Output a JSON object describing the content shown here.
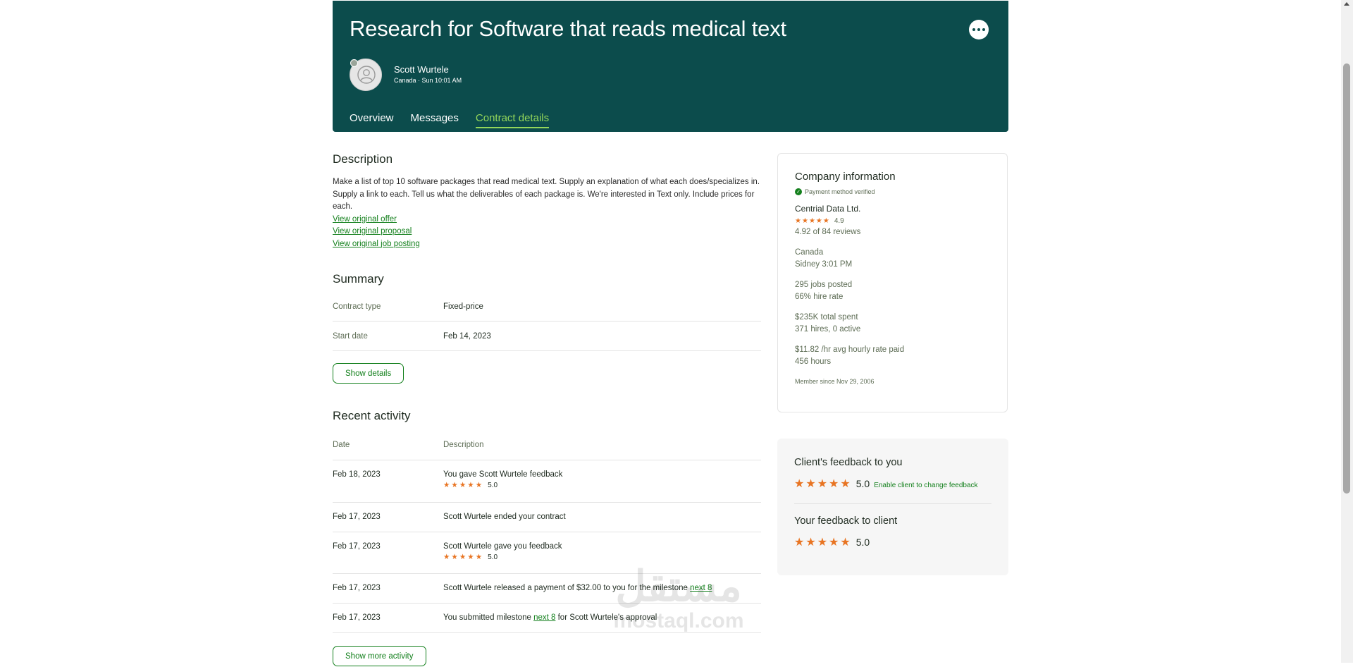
{
  "header": {
    "title": "Research for Software that reads medical text",
    "more_icon": "more-horizontal-icon",
    "owner": {
      "name": "Scott Wurtele",
      "meta": "Canada · Sun 10:01 AM"
    },
    "tabs": [
      {
        "label": "Overview",
        "active": false
      },
      {
        "label": "Messages",
        "active": false
      },
      {
        "label": "Contract details",
        "active": true
      }
    ]
  },
  "description": {
    "heading": "Description",
    "text": "Make a list of top 10 software packages that read medical text. Supply an explanation of what each does/specializes in. Supply a link to each. Tell us what the deliverables of each package is. We're interested in Text only. Include prices for each.",
    "links": [
      "View original offer",
      "View original proposal",
      "View original job posting"
    ]
  },
  "summary": {
    "heading": "Summary",
    "rows": [
      {
        "label": "Contract type",
        "value": "Fixed-price"
      },
      {
        "label": "Start date",
        "value": "Feb 14, 2023"
      }
    ],
    "button": "Show details"
  },
  "activity": {
    "heading": "Recent activity",
    "col_date": "Date",
    "col_desc": "Description",
    "rows": [
      {
        "date": "Feb 18, 2023",
        "text": "You gave Scott Wurtele feedback",
        "rating": "5.0"
      },
      {
        "date": "Feb 17, 2023",
        "text": "Scott Wurtele ended your contract"
      },
      {
        "date": "Feb 17, 2023",
        "text": "Scott Wurtele gave you feedback",
        "rating": "5.0"
      },
      {
        "date": "Feb 17, 2023",
        "text_before": "Scott Wurtele released a payment of $32.00 to you for the milestone ",
        "link": "next 8",
        "text_after": ""
      },
      {
        "date": "Feb 17, 2023",
        "text_before": "You submitted milestone ",
        "link": "next 8",
        "text_after": " for Scott Wurtele's approval"
      }
    ],
    "button": "Show more activity"
  },
  "company": {
    "heading": "Company information",
    "verified": "Payment method verified",
    "name": "Centrial Data Ltd.",
    "rating": "4.9",
    "reviews": "4.92 of 84 reviews",
    "country": "Canada",
    "city_time": "Sidney 3:01 PM",
    "jobs_posted": "295 jobs posted",
    "hire_rate": "66% hire rate",
    "total_spent": "$235K total spent",
    "hires": "371 hires, 0 active",
    "avg_rate": "$11.82 /hr avg hourly rate paid",
    "hours": "456 hours",
    "member_since": "Member since Nov 29, 2006"
  },
  "feedback": {
    "client_heading": "Client's feedback to you",
    "client_score": "5.0",
    "enable_link": "Enable client to change feedback",
    "your_heading": "Your feedback to client",
    "your_score": "5.0"
  },
  "watermark": {
    "arabic": "مستقل",
    "latin": "mostaql.com"
  },
  "colors": {
    "header_bg": "#0c4c4c",
    "accent_green": "#14801d",
    "active_tab": "#93d65a",
    "star": "#e87422"
  }
}
